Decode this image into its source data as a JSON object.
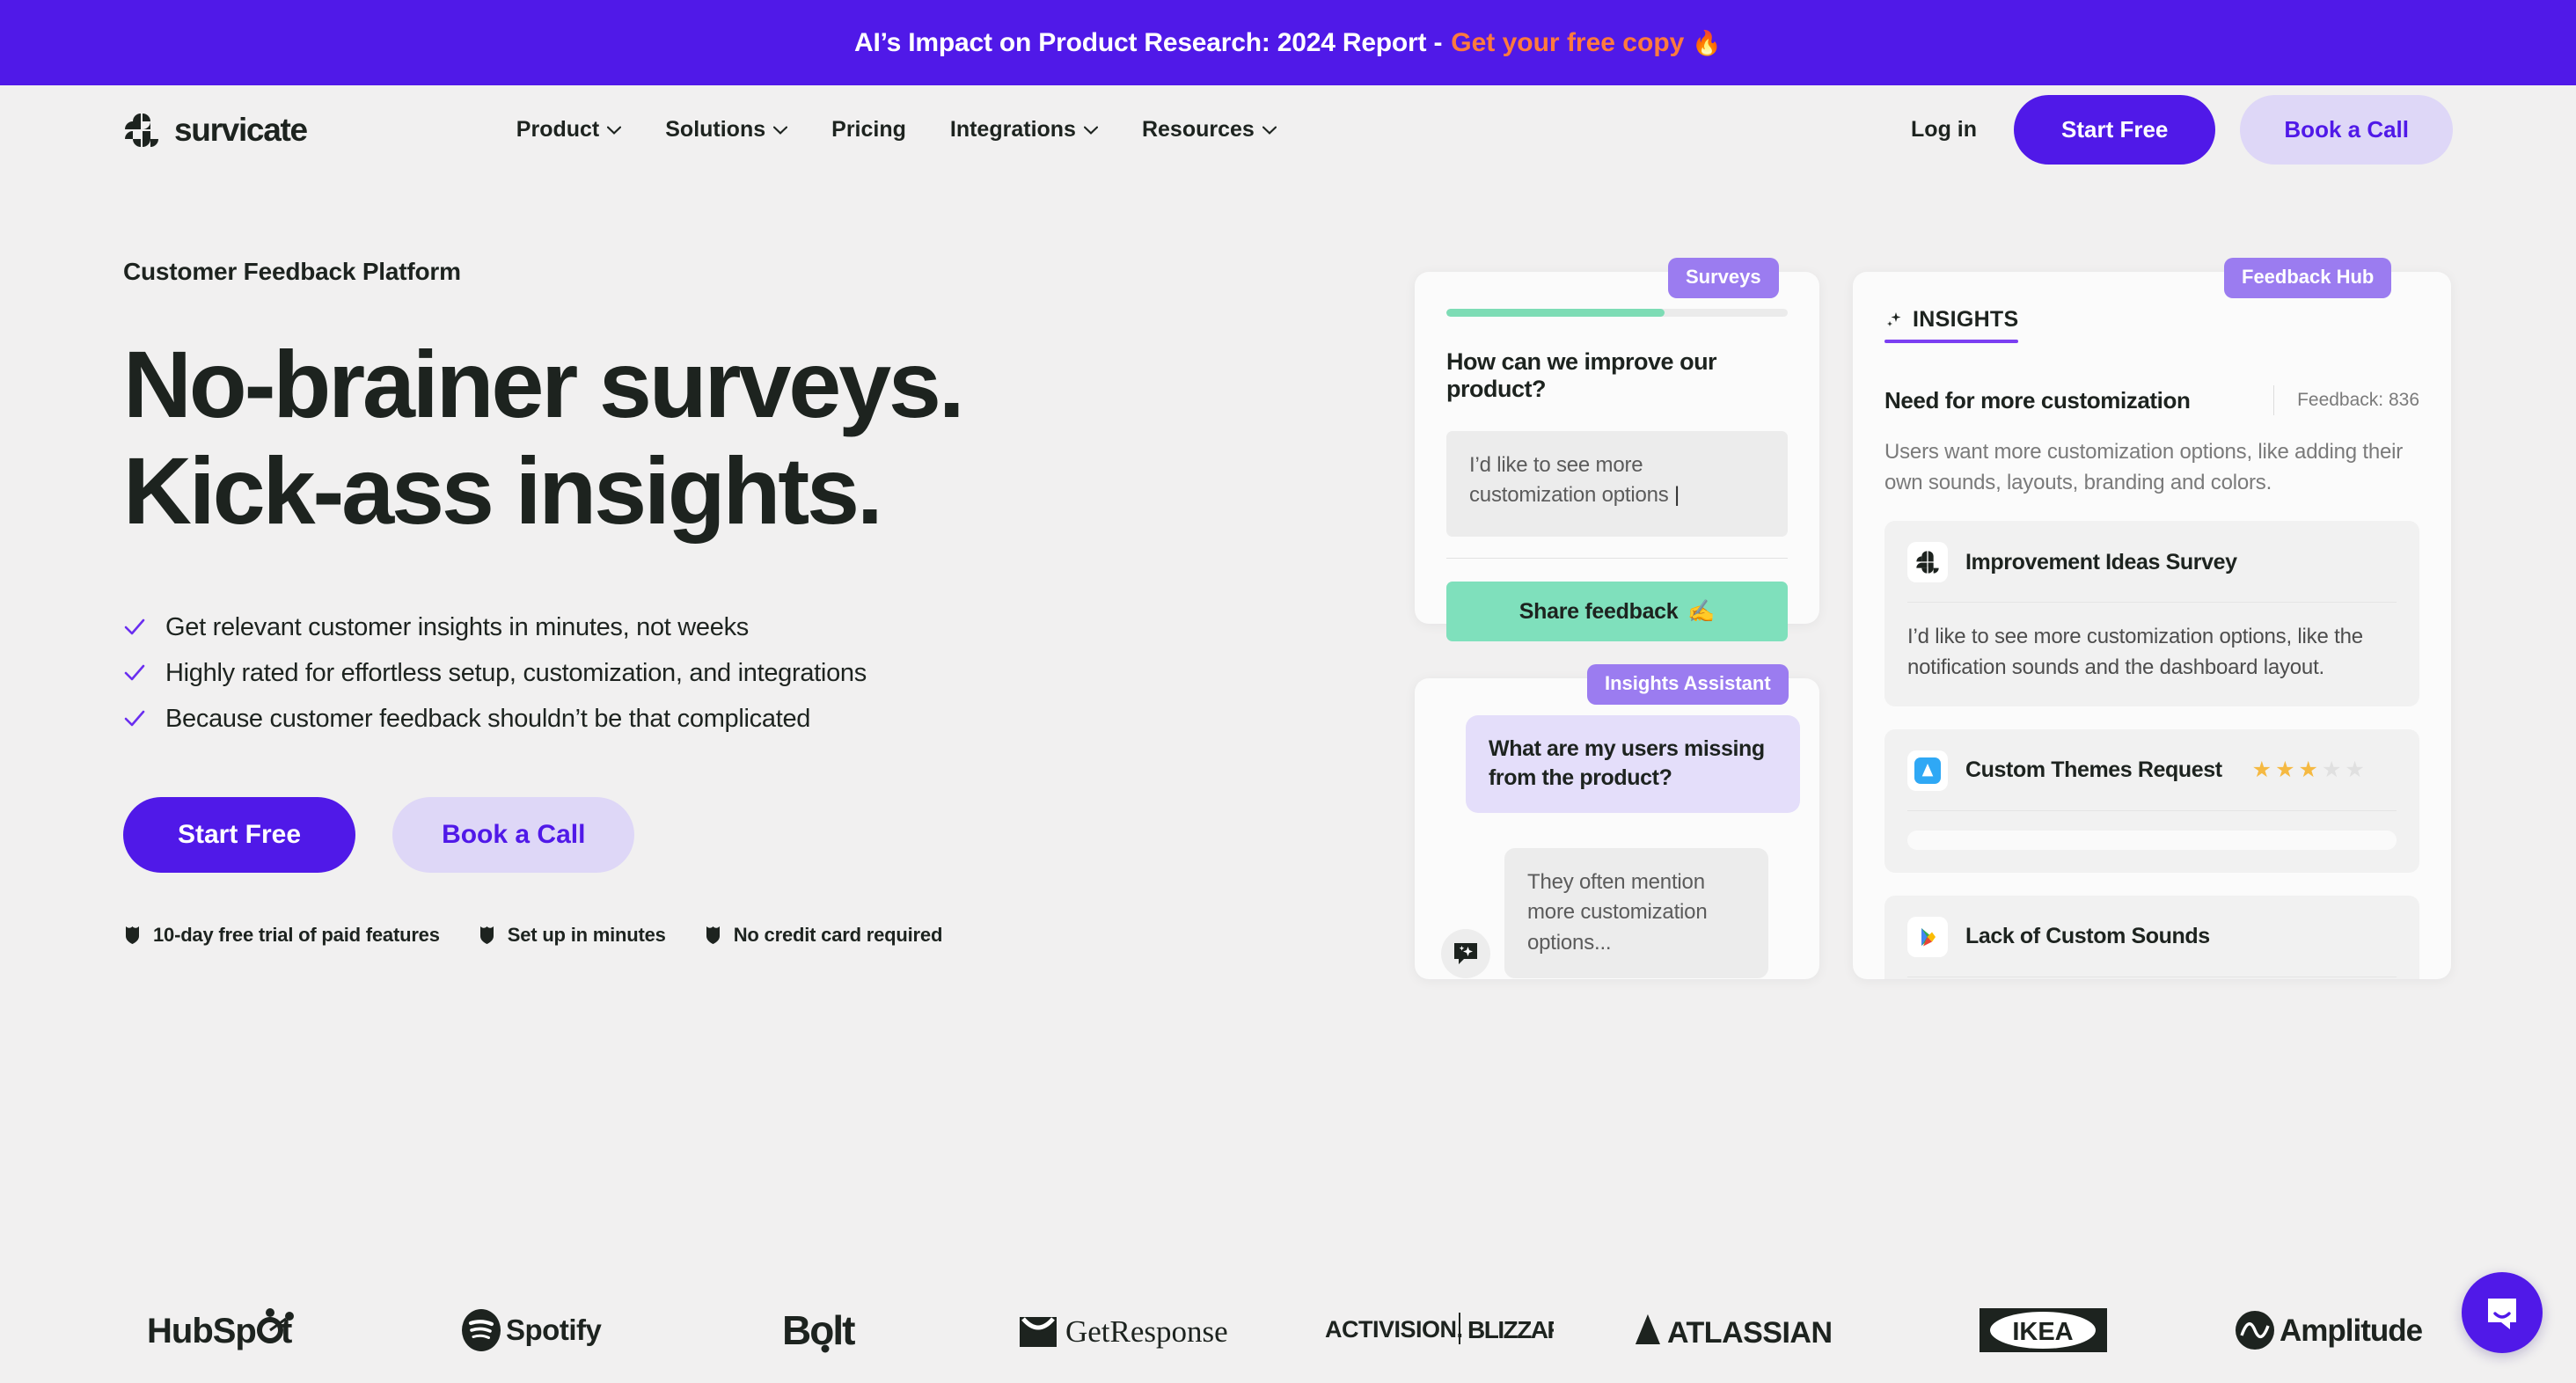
{
  "banner": {
    "text": "AI’s Impact on Product Research: 2024 Report -",
    "link_label": "Get your free copy",
    "emoji": "🔥"
  },
  "header": {
    "logo_text": "survicate",
    "nav": [
      {
        "label": "Product",
        "has_chevron": true
      },
      {
        "label": "Solutions",
        "has_chevron": true
      },
      {
        "label": "Pricing",
        "has_chevron": false
      },
      {
        "label": "Integrations",
        "has_chevron": true
      },
      {
        "label": "Resources",
        "has_chevron": true
      }
    ],
    "login_label": "Log in",
    "start_free_label": "Start Free",
    "book_call_label": "Book a Call"
  },
  "hero": {
    "eyebrow": "Customer Feedback Platform",
    "headline_line1": "No-brainer surveys.",
    "headline_line2": "Kick-ass insights.",
    "bullets": [
      "Get relevant customer insights in minutes, not weeks",
      "Highly rated for effortless setup, customization, and integrations",
      "Because customer feedback shouldn’t be that complicated"
    ],
    "cta_primary": "Start Free",
    "cta_secondary": "Book a Call",
    "trust": [
      "10-day free trial of paid features",
      "Set up in minutes",
      "No credit card required"
    ]
  },
  "surveys_card": {
    "pill": "Surveys",
    "progress_percent": 64,
    "question": "How can we improve our product?",
    "answer_value": "I’d like to see more customization options",
    "submit_label": "Share feedback",
    "submit_emoji": "✍️"
  },
  "assistant_card": {
    "pill": "Insights Assistant",
    "question": "What are my users missing from the product?",
    "answer": "They often mention more customization options..."
  },
  "hub_card": {
    "pill": "Feedback Hub",
    "tab_label": "INSIGHTS",
    "insight_title": "Need for more customization",
    "feedback_count_label": "Feedback: 836",
    "insight_description": "Users want more customization options, like adding their own sounds, layouts, branding and colors.",
    "items": [
      {
        "name": "Improvement Ideas Survey",
        "source_icon": "survicate-icon",
        "body": "I’d like to see more customization options, like the notification sounds and the dashboard layout.",
        "stars_filled": 0,
        "stars_total": 0
      },
      {
        "name": "Custom Themes Request",
        "source_icon": "app-store-icon",
        "body": "",
        "stars_filled": 3,
        "stars_total": 5
      },
      {
        "name": "Lack of Custom Sounds",
        "source_icon": "google-play-icon",
        "body": "",
        "stars_filled": 0,
        "stars_total": 0
      }
    ]
  },
  "logos": [
    "HubSpot",
    "Spotify",
    "Bolt",
    "GetResponse",
    "ACTIVISION | BLIZZARD",
    "ATLASSIAN",
    "IKEA",
    "Amplitude"
  ],
  "colors": {
    "brand_purple": "#5019e8",
    "banner_link_orange": "#ff7a3d",
    "pill_purple": "#9b7cf0",
    "soft_purple": "#ded7f7",
    "mint": "#7fe0bc",
    "star_gold": "#f5b942",
    "page_bg": "#f1f0f0",
    "text_dark": "#1d231f"
  },
  "chat_widget": {
    "name": "intercom-launcher"
  }
}
